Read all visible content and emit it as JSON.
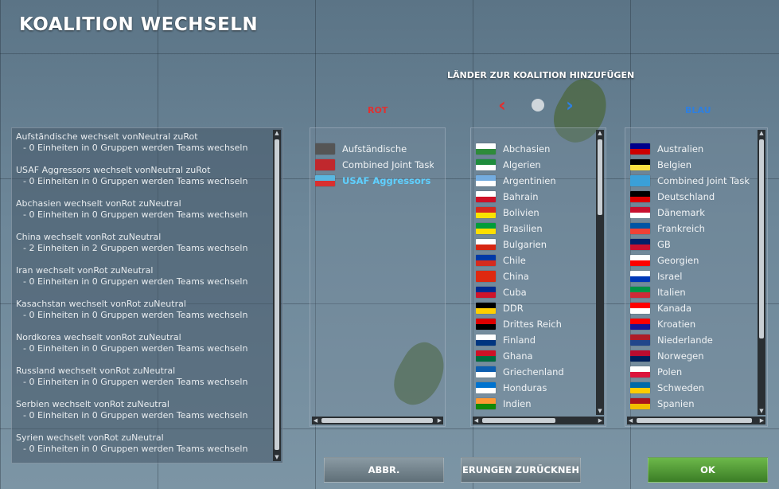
{
  "title": "KOALITION WECHSELN",
  "add_countries_label": "LÄNDER ZUR KOALITION HINZUFÜGEN",
  "red_label": "ROT",
  "blue_label": "BLAU",
  "arrow_left": "‹",
  "arrow_right": "›",
  "log": [
    {
      "title": "Aufständische wechselt vonNeutral zuRot",
      "detail": "- 0 Einheiten in 0 Gruppen werden Teams wechseln"
    },
    {
      "title": "USAF Aggressors wechselt vonNeutral zuRot",
      "detail": "- 0 Einheiten in 0 Gruppen werden Teams wechseln"
    },
    {
      "title": "Abchasien wechselt vonRot zuNeutral",
      "detail": "- 0 Einheiten in 0 Gruppen werden Teams wechseln"
    },
    {
      "title": "China wechselt vonRot zuNeutral",
      "detail": "- 2 Einheiten in 2 Gruppen werden Teams wechseln"
    },
    {
      "title": "Iran wechselt vonRot zuNeutral",
      "detail": "- 0 Einheiten in 0 Gruppen werden Teams wechseln"
    },
    {
      "title": "Kasachstan wechselt vonRot zuNeutral",
      "detail": "- 0 Einheiten in 0 Gruppen werden Teams wechseln"
    },
    {
      "title": "Nordkorea wechselt vonRot zuNeutral",
      "detail": "- 0 Einheiten in 0 Gruppen werden Teams wechseln"
    },
    {
      "title": "Russland wechselt vonRot zuNeutral",
      "detail": "- 0 Einheiten in 0 Gruppen werden Teams wechseln"
    },
    {
      "title": "Serbien wechselt vonRot zuNeutral",
      "detail": "- 0 Einheiten in 0 Gruppen werden Teams wechseln"
    },
    {
      "title": "Syrien wechselt vonRot zuNeutral",
      "detail": "- 0 Einheiten in 0 Gruppen werden Teams wechseln"
    }
  ],
  "red_countries": [
    {
      "name": "Aufständische",
      "flag": [
        "#555555",
        "#555555"
      ],
      "selected": false
    },
    {
      "name": "Combined Joint Task Fo",
      "flag": [
        "#c0282d",
        "#c0282d"
      ],
      "selected": false
    },
    {
      "name": "USAF Aggressors",
      "flag": [
        "#59b7e0",
        "#d83030"
      ],
      "selected": true
    }
  ],
  "neutral_countries": [
    {
      "name": "Abchasien",
      "flag": [
        "#ffffff",
        "#2e8b3a"
      ]
    },
    {
      "name": "Algerien",
      "flag": [
        "#1e8c3c",
        "#ffffff"
      ]
    },
    {
      "name": "Argentinien",
      "flag": [
        "#74acdf",
        "#ffffff"
      ]
    },
    {
      "name": "Bahrain",
      "flag": [
        "#ffffff",
        "#ce1126"
      ]
    },
    {
      "name": "Bolivien",
      "flag": [
        "#d52b1e",
        "#f9e300"
      ]
    },
    {
      "name": "Brasilien",
      "flag": [
        "#009c3b",
        "#ffdf00"
      ]
    },
    {
      "name": "Bulgarien",
      "flag": [
        "#ffffff",
        "#d62612"
      ]
    },
    {
      "name": "Chile",
      "flag": [
        "#0039a6",
        "#d52b1e"
      ]
    },
    {
      "name": "China",
      "flag": [
        "#de2910",
        "#de2910"
      ]
    },
    {
      "name": "Cuba",
      "flag": [
        "#002a8f",
        "#cf142b"
      ]
    },
    {
      "name": "DDR",
      "flag": [
        "#000000",
        "#ffce00"
      ]
    },
    {
      "name": "Drittes Reich",
      "flag": [
        "#dd0000",
        "#000000"
      ]
    },
    {
      "name": "Finland",
      "flag": [
        "#ffffff",
        "#003580"
      ]
    },
    {
      "name": "Ghana",
      "flag": [
        "#ce1126",
        "#006b3f"
      ]
    },
    {
      "name": "Griechenland",
      "flag": [
        "#0d5eaf",
        "#ffffff"
      ]
    },
    {
      "name": "Honduras",
      "flag": [
        "#0073cf",
        "#ffffff"
      ]
    },
    {
      "name": "Indien",
      "flag": [
        "#ff9933",
        "#138808"
      ]
    }
  ],
  "blue_countries": [
    {
      "name": "Australien",
      "flag": [
        "#00008b",
        "#cc0000"
      ]
    },
    {
      "name": "Belgien",
      "flag": [
        "#000000",
        "#fae042"
      ]
    },
    {
      "name": "Combined Joint Task",
      "flag": [
        "#3aa0d8",
        "#3aa0d8"
      ]
    },
    {
      "name": "Deutschland",
      "flag": [
        "#000000",
        "#dd0000"
      ]
    },
    {
      "name": "Dänemark",
      "flag": [
        "#c8102e",
        "#ffffff"
      ]
    },
    {
      "name": "Frankreich",
      "flag": [
        "#0055a4",
        "#ef4135"
      ]
    },
    {
      "name": "GB",
      "flag": [
        "#012169",
        "#c8102e"
      ]
    },
    {
      "name": "Georgien",
      "flag": [
        "#ffffff",
        "#ff0000"
      ]
    },
    {
      "name": "Israel",
      "flag": [
        "#ffffff",
        "#0038b8"
      ]
    },
    {
      "name": "Italien",
      "flag": [
        "#009246",
        "#ce2b37"
      ]
    },
    {
      "name": "Kanada",
      "flag": [
        "#ff0000",
        "#ffffff"
      ]
    },
    {
      "name": "Kroatien",
      "flag": [
        "#ff0000",
        "#171796"
      ]
    },
    {
      "name": "Niederlande",
      "flag": [
        "#ae1c28",
        "#21468b"
      ]
    },
    {
      "name": "Norwegen",
      "flag": [
        "#ba0c2f",
        "#00205b"
      ]
    },
    {
      "name": "Polen",
      "flag": [
        "#ffffff",
        "#dc143c"
      ]
    },
    {
      "name": "Schweden",
      "flag": [
        "#006aa7",
        "#fecc00"
      ]
    },
    {
      "name": "Spanien",
      "flag": [
        "#aa151b",
        "#f1bf00"
      ]
    }
  ],
  "buttons": {
    "cancel": "ABBR.",
    "undo": "ERUNGEN ZURÜCKNEH",
    "ok": "OK"
  },
  "colors": {
    "red": "#e03030",
    "blue": "#2e7fe0",
    "selected": "#5fd0ff",
    "ok_button": "#4e9a32"
  }
}
